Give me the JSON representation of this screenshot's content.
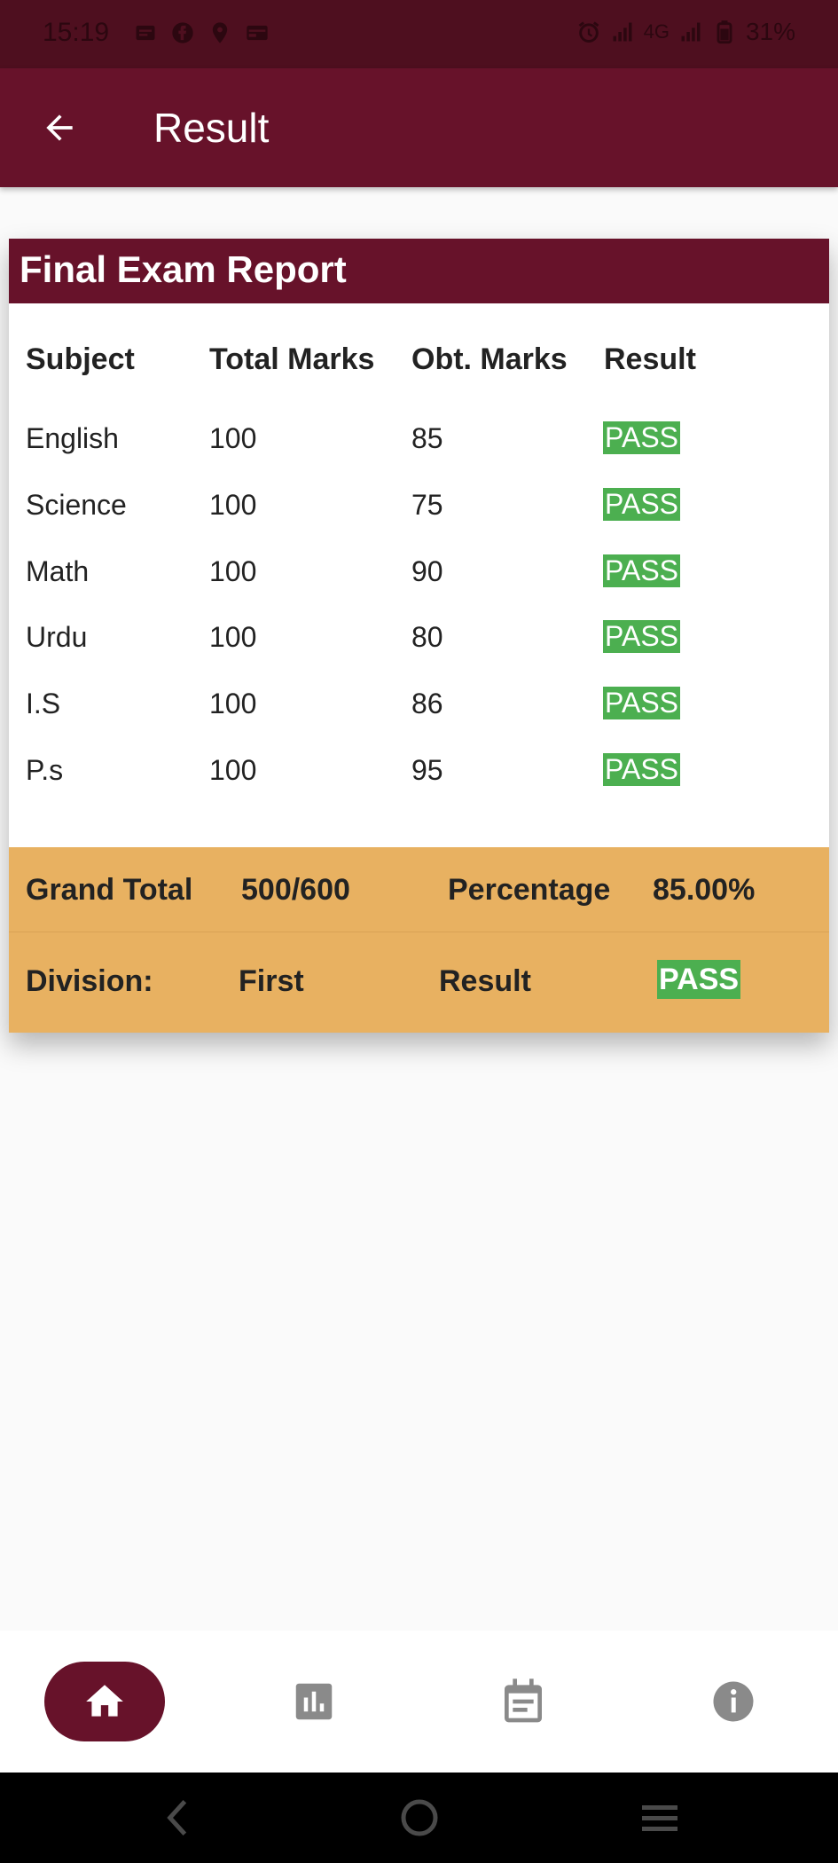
{
  "status_bar": {
    "time": "15:19",
    "network": "4G",
    "battery": "31%"
  },
  "app_bar": {
    "title": "Result"
  },
  "report": {
    "title": "Final Exam Report",
    "columns": [
      "Subject",
      "Total Marks",
      "Obt. Marks",
      "Result"
    ],
    "rows": [
      {
        "subject": "English",
        "total": "100",
        "obtained": "85",
        "result": "PASS"
      },
      {
        "subject": "Science",
        "total": "100",
        "obtained": "75",
        "result": "PASS"
      },
      {
        "subject": "Math",
        "total": "100",
        "obtained": "90",
        "result": "PASS"
      },
      {
        "subject": "Urdu",
        "total": "100",
        "obtained": "80",
        "result": "PASS"
      },
      {
        "subject": "I.S",
        "total": "100",
        "obtained": "86",
        "result": "PASS"
      },
      {
        "subject": "P.s",
        "total": "100",
        "obtained": "95",
        "result": "PASS"
      }
    ],
    "summary": {
      "grand_total_label": "Grand Total",
      "grand_total_value": "500/600",
      "percentage_label": "Percentage",
      "percentage_value": "85.00%",
      "division_label": "Division:",
      "division_value": "First",
      "result_label": "Result",
      "result_value": "PASS"
    }
  },
  "bottom_nav": {
    "items": [
      {
        "icon": "home-icon",
        "active": true
      },
      {
        "icon": "bar-chart-icon",
        "active": false
      },
      {
        "icon": "calendar-icon",
        "active": false
      },
      {
        "icon": "info-icon",
        "active": false
      }
    ]
  },
  "colors": {
    "primary": "#67122a",
    "status_bar": "#4e0f1f",
    "summary_bg": "#e8b161",
    "pass": "#4caf50",
    "nav_icon_inactive": "#8a8a8a"
  }
}
